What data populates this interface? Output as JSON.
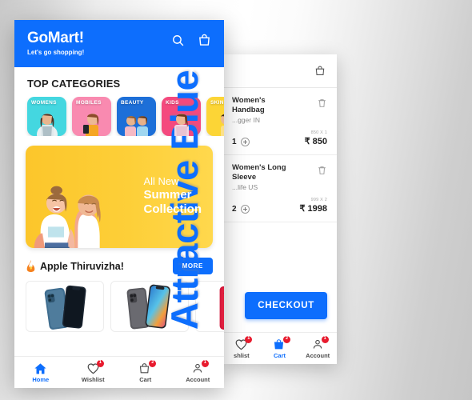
{
  "caption": {
    "text": "Attractive Blue",
    "color": "#0d6efd"
  },
  "theme": {
    "primary_blue": "#0d6efd",
    "badge_red": "#e81b2e",
    "banner_yellow": "#fcc62b"
  },
  "home_screen": {
    "header": {
      "brand": "GoMart!",
      "tagline": "Let's go shopping!",
      "search_icon": "search-icon",
      "bag_icon": "shopping-bag-icon"
    },
    "categories_title": "TOP CATEGORIES",
    "categories": [
      {
        "label": "WOMENS",
        "color": "#44d7e0"
      },
      {
        "label": "MOBILES",
        "color": "#f98ab0"
      },
      {
        "label": "BEAUTY",
        "color": "#1d6fd8"
      },
      {
        "label": "KIDS",
        "color": "#f4497e"
      },
      {
        "label": "SKIN",
        "color": "#fcd536"
      }
    ],
    "banner": {
      "line1": "All New",
      "line2": "Summer",
      "line3": "Collection"
    },
    "apple_section": {
      "title": "Apple Thiruvizha!",
      "fire_icon": "fire-icon",
      "more_label": "MORE"
    },
    "products": [
      {
        "name": "iPhone 12 Pro Pacific Blue",
        "color": "#3f6d8f"
      },
      {
        "name": "iPhone 13 Pro Graphite",
        "color": "#5a5a5f"
      },
      {
        "name": "iPhone SE Product Red",
        "color": "#d3173a"
      }
    ],
    "bottom_nav": [
      {
        "label": "Home",
        "icon": "home-icon",
        "badge": "",
        "active": true
      },
      {
        "label": "Wishlist",
        "icon": "heart-icon",
        "badge": "1",
        "active": false
      },
      {
        "label": "Cart",
        "icon": "shopping-bag-icon",
        "badge": "2",
        "active": false
      },
      {
        "label": "Account",
        "icon": "person-icon",
        "badge": "1",
        "active": false
      }
    ]
  },
  "cart_screen": {
    "header": {
      "bag_icon": "shopping-bag-icon"
    },
    "items": [
      {
        "title": "Women's Handbag",
        "brand": "...gger IN",
        "qty": "1",
        "unit_line": "850 X 1",
        "price": "₹ 850",
        "delete_icon": "trash-icon",
        "plus_icon": "plus-circle-icon"
      },
      {
        "title": "Women's Long Sleeve",
        "brand": "...life US",
        "qty": "2",
        "unit_line": "999 X 2",
        "price": "₹ 1998",
        "delete_icon": "trash-icon",
        "plus_icon": "plus-circle-icon"
      }
    ],
    "checkout_label": "CHECKOUT",
    "bottom_nav": [
      {
        "label": "shlist",
        "icon": "heart-icon",
        "badge": "1",
        "active": false
      },
      {
        "label": "Cart",
        "icon": "shopping-bag-icon",
        "badge": "2",
        "active": true
      },
      {
        "label": "Account",
        "icon": "person-icon",
        "badge": "1",
        "active": false
      }
    ]
  }
}
